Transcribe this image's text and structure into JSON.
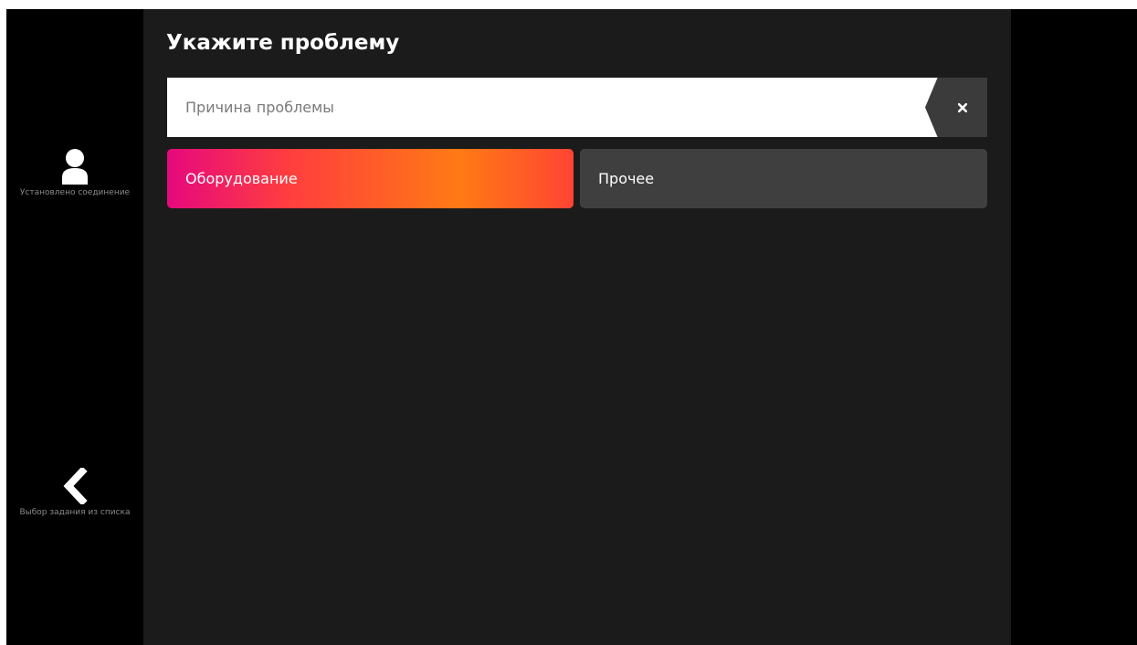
{
  "sidebar": {
    "user_label": "Установлено соединение",
    "user_icon": "user-icon",
    "back_label": "Выбор задания из списка",
    "back_icon": "chevron-left-icon"
  },
  "main": {
    "title": "Укажите проблему",
    "search": {
      "value": "",
      "placeholder": "Причина проблемы",
      "clear_icon": "close-icon"
    },
    "categories": [
      {
        "label": "Оборудование",
        "selected": true
      },
      {
        "label": "Прочее",
        "selected": false
      }
    ]
  },
  "colors": {
    "background": "#000000",
    "panel": "#1b1b1b",
    "button": "#3f3f3f",
    "accent_gradient": [
      "#e6087e",
      "#ff3e3e",
      "#ff7a14",
      "#ff4433"
    ],
    "text": "#ffffff"
  }
}
